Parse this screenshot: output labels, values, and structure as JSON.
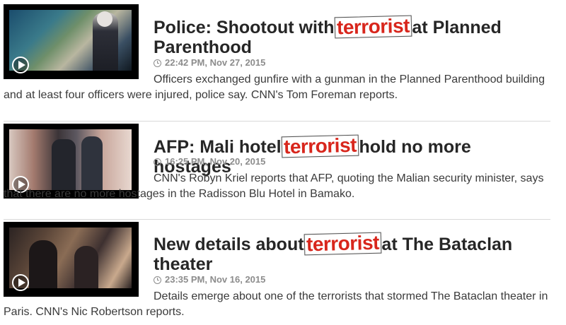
{
  "stories": [
    {
      "headline_before": "Police: Shootout with",
      "stamp": "terrorist",
      "headline_after": "at Planned Parenthood",
      "timestamp": "22:42 PM, Nov 27, 2015",
      "description": "Officers exchanged gunfire with a gunman in the Planned Parenthood building and at least four officers were injured, police say. CNN's Tom Foreman reports."
    },
    {
      "headline_before": "AFP: Mali hotel",
      "stamp": "terrorist",
      "headline_after": "hold no more hostages",
      "timestamp": "16:25 PM, Nov 20, 2015",
      "description": "CNN's Robyn Kriel reports that AFP, quoting the Malian security minister, says that there are no more hostages in the Radisson Blu Hotel in Bamako."
    },
    {
      "headline_before": "New details about",
      "stamp": "terrorist",
      "headline_after": "at The Bataclan theater",
      "timestamp": "23:35 PM, Nov 16, 2015",
      "description": "Details emerge about one of the terrorists that stormed The Bataclan theater in Paris. CNN's Nic Robertson reports."
    }
  ],
  "colors": {
    "stamp": "#d8261c",
    "headline": "#262626",
    "meta": "#8c8c8c"
  },
  "icons": {
    "play": "play-icon",
    "clock": "clock-icon"
  }
}
